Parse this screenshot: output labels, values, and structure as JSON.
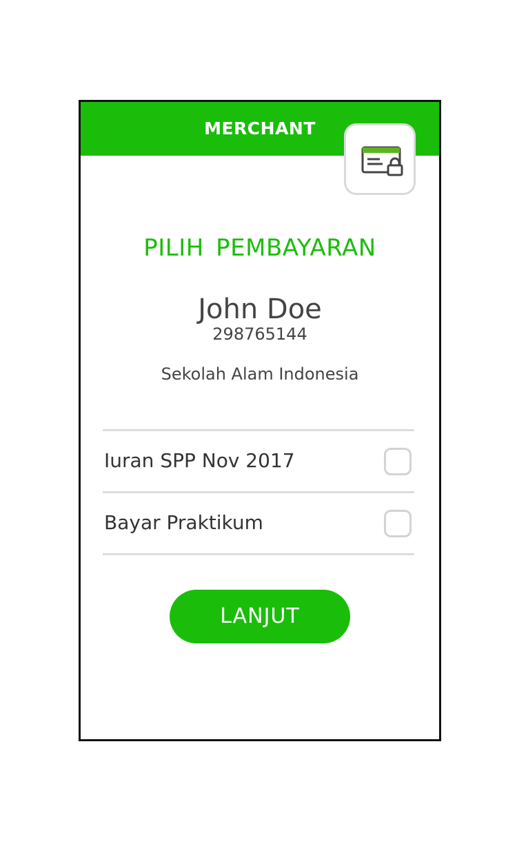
{
  "header": {
    "title": "MERCHANT",
    "badge_icon": "card-lock-icon"
  },
  "page": {
    "title": "PILIH  PEMBAYARAN"
  },
  "customer": {
    "name": "John Doe",
    "account_number": "298765144",
    "school": "Sekolah Alam Indonesia"
  },
  "payments": [
    {
      "label": "Iuran SPP Nov 2017",
      "checked": false
    },
    {
      "label": "Bayar Praktikum",
      "checked": false
    }
  ],
  "actions": {
    "next_label": "LANJUT"
  },
  "colors": {
    "accent": "#1bbd0b",
    "text": "#444444",
    "divider": "#dcdcdc",
    "frame_border": "#111111"
  }
}
